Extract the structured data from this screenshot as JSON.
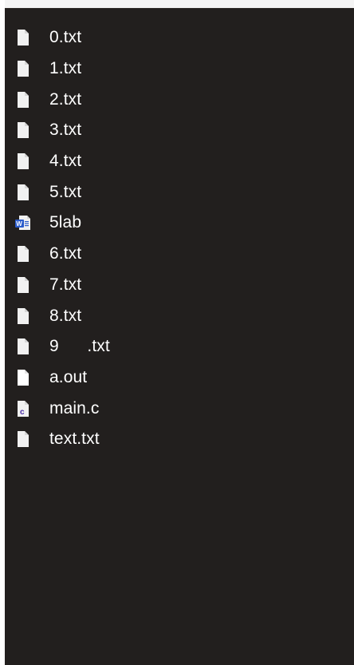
{
  "files": [
    {
      "name": "0.txt",
      "icon": "text-file-icon"
    },
    {
      "name": "1.txt",
      "icon": "text-file-icon"
    },
    {
      "name": "2.txt",
      "icon": "text-file-icon"
    },
    {
      "name": "3.txt",
      "icon": "text-file-icon"
    },
    {
      "name": "4.txt",
      "icon": "text-file-icon"
    },
    {
      "name": "5.txt",
      "icon": "text-file-icon"
    },
    {
      "name": "5lab",
      "icon": "word-document-icon"
    },
    {
      "name": "6.txt",
      "icon": "text-file-icon"
    },
    {
      "name": "7.txt",
      "icon": "text-file-icon"
    },
    {
      "name": "8.txt",
      "icon": "text-file-icon"
    },
    {
      "name": "9      .txt",
      "icon": "text-file-icon"
    },
    {
      "name": "a.out",
      "icon": "executable-file-icon"
    },
    {
      "name": "main.c",
      "icon": "c-source-file-icon"
    },
    {
      "name": "text.txt",
      "icon": "text-file-icon"
    }
  ],
  "colors": {
    "background": "#221f1e",
    "text": "#ffffff",
    "icon_fill": "#f1f1f1",
    "word_icon_accent": "#2b5ccb",
    "c_icon_accent": "#4a2da7"
  }
}
